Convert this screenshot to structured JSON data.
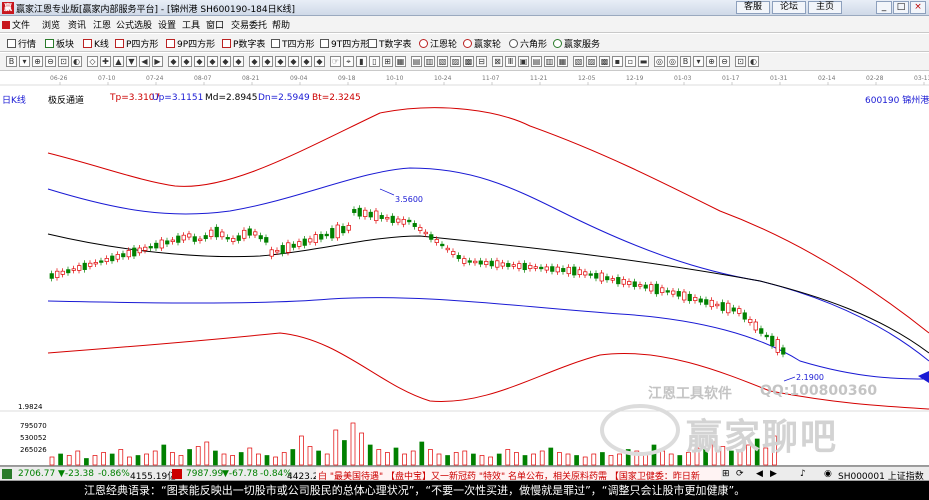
{
  "window": {
    "title": "赢家江恩专业版[赢家内部服务平台] - [锦州港  SH600190-184日K线]",
    "links": [
      "客服",
      "论坛",
      "主页"
    ],
    "controls": [
      "_",
      "□",
      "×"
    ]
  },
  "menu": [
    "文件",
    "浏览",
    "资讯",
    "江恩",
    "公式选股",
    "设置",
    "工具",
    "窗口",
    "交易委托",
    "帮助"
  ],
  "toolbar": [
    "行情",
    "板块",
    "K线",
    "P四方形",
    "9P四方形",
    "P数字表",
    "T四方形",
    "9T四方形",
    "T数字表",
    "江恩轮",
    "赢家轮",
    "六角形",
    "赢家服务"
  ],
  "chart": {
    "period": "日K线",
    "indicator": "极反通道",
    "tp": "Tp=3.3107",
    "up": "Up=3.1151",
    "md": "Md=2.8945",
    "dn": "Dn=2.5949",
    "bt": "Bt=2.3245",
    "code_name": "600190 锦州港",
    "dates": [
      "06-26",
      "07-10",
      "07-24",
      "08-07",
      "08-21",
      "09-04",
      "09-18",
      "10-10",
      "10-24",
      "11-07",
      "11-21",
      "12-05",
      "12-19",
      "01-03",
      "01-17",
      "01-31",
      "02-14",
      "02-28",
      "03-13"
    ],
    "high_label": "3.5600",
    "low_label": "2.1900",
    "vol_max": "1.9824",
    "vol_ticks": [
      "795070",
      "530052",
      "265026"
    ],
    "colors": {
      "up": "#e00000",
      "down": "#008000",
      "channel_outer": "#d40000",
      "channel_inner": "#1a1ad4",
      "mid": "#000000",
      "volume_up": "#e00000",
      "volume_down": "#008000"
    }
  },
  "watermark": {
    "software": "江恩工具软件",
    "qq": "QQ:100800360",
    "brand": "赢家聊吧",
    "logo_text": "江恩"
  },
  "ticker": {
    "sh_value": "2706.77",
    "sh_change": "▼-23.38",
    "sh_pct": "-0.86%",
    "sh_amount": "4155.19亿",
    "sz_value": "7987.99",
    "sz_change": "▼-67.78",
    "sz_pct": "-0.84%",
    "sz_amount": "4423.23亿",
    "news_text": "白  \"最美国待遇\" 【盘中宝】又一新冠药 \"特效\" 名单公布，相关原料药需  【国家卫健委：昨日新",
    "index_code": "SH000001 上证指数"
  },
  "quote": "江恩经典语录：“图表能反映出一切股市或公司股民的总体心理状况”，“不要一次性买进，做慢就是罪过”，“调整只会让股市更加健康”。"
}
